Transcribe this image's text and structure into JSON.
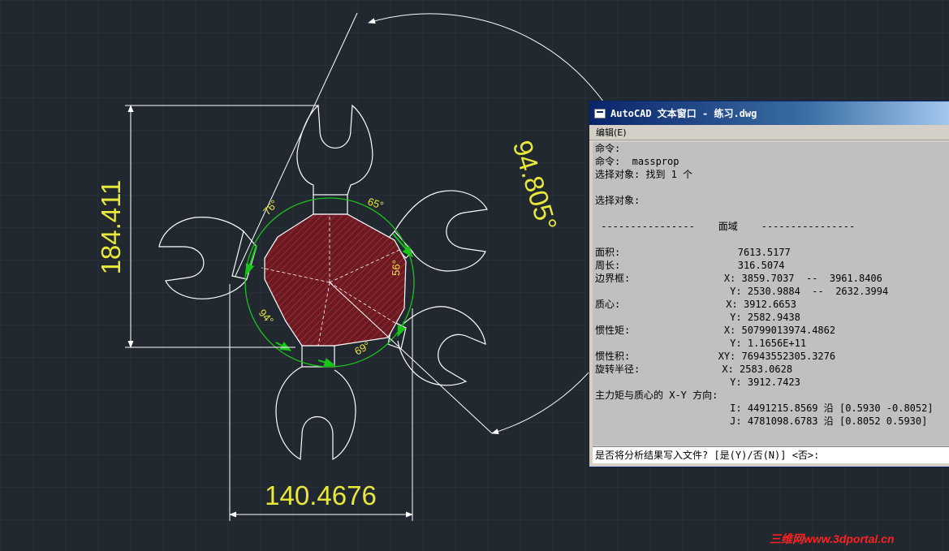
{
  "drawing": {
    "dim_height": "184.411",
    "dim_width": "140.4676",
    "dim_arc": "94.805°",
    "angles": [
      "76°",
      "65°",
      "56°",
      "69°",
      "94°"
    ]
  },
  "text_window": {
    "title": "AutoCAD 文本窗口 - 练习.dwg",
    "menu_edit": "编辑(E)",
    "lines": [
      "命令:",
      "命令:  massprop",
      "选择对象: 找到 1 个",
      "",
      "选择对象:",
      "",
      " ----------------    面域    ----------------",
      "",
      "面积:                    7613.5177",
      "周长:                    316.5074",
      "边界框:                X: 3859.7037  --  3961.8406",
      "                       Y: 2530.9884  --  2632.3994",
      "质心:                  X: 3912.6653",
      "                       Y: 2582.9438",
      "惯性矩:                X: 50799013974.4862",
      "                       Y: 1.1656E+11",
      "惯性积:               XY: 76943552305.3276",
      "旋转半径:              X: 2583.0628",
      "                       Y: 3912.7423",
      "主力矩与质心的 X-Y 方向:",
      "                       I: 4491215.8569 沿 [0.5930 -0.8052]",
      "                       J: 4781098.6783 沿 [0.8052 0.5930]"
    ],
    "prompt": "是否将分析结果写入文件? [是(Y)/否(N)] <否>:"
  },
  "watermark": "三维网www.3dportal.cn",
  "colors": {
    "background": "#212830",
    "grid": "#2b333d",
    "geometry": "#ffffff",
    "dimension": "#e8e83a",
    "hatch": "#7a1f26",
    "angle_dims": "#19c419"
  }
}
